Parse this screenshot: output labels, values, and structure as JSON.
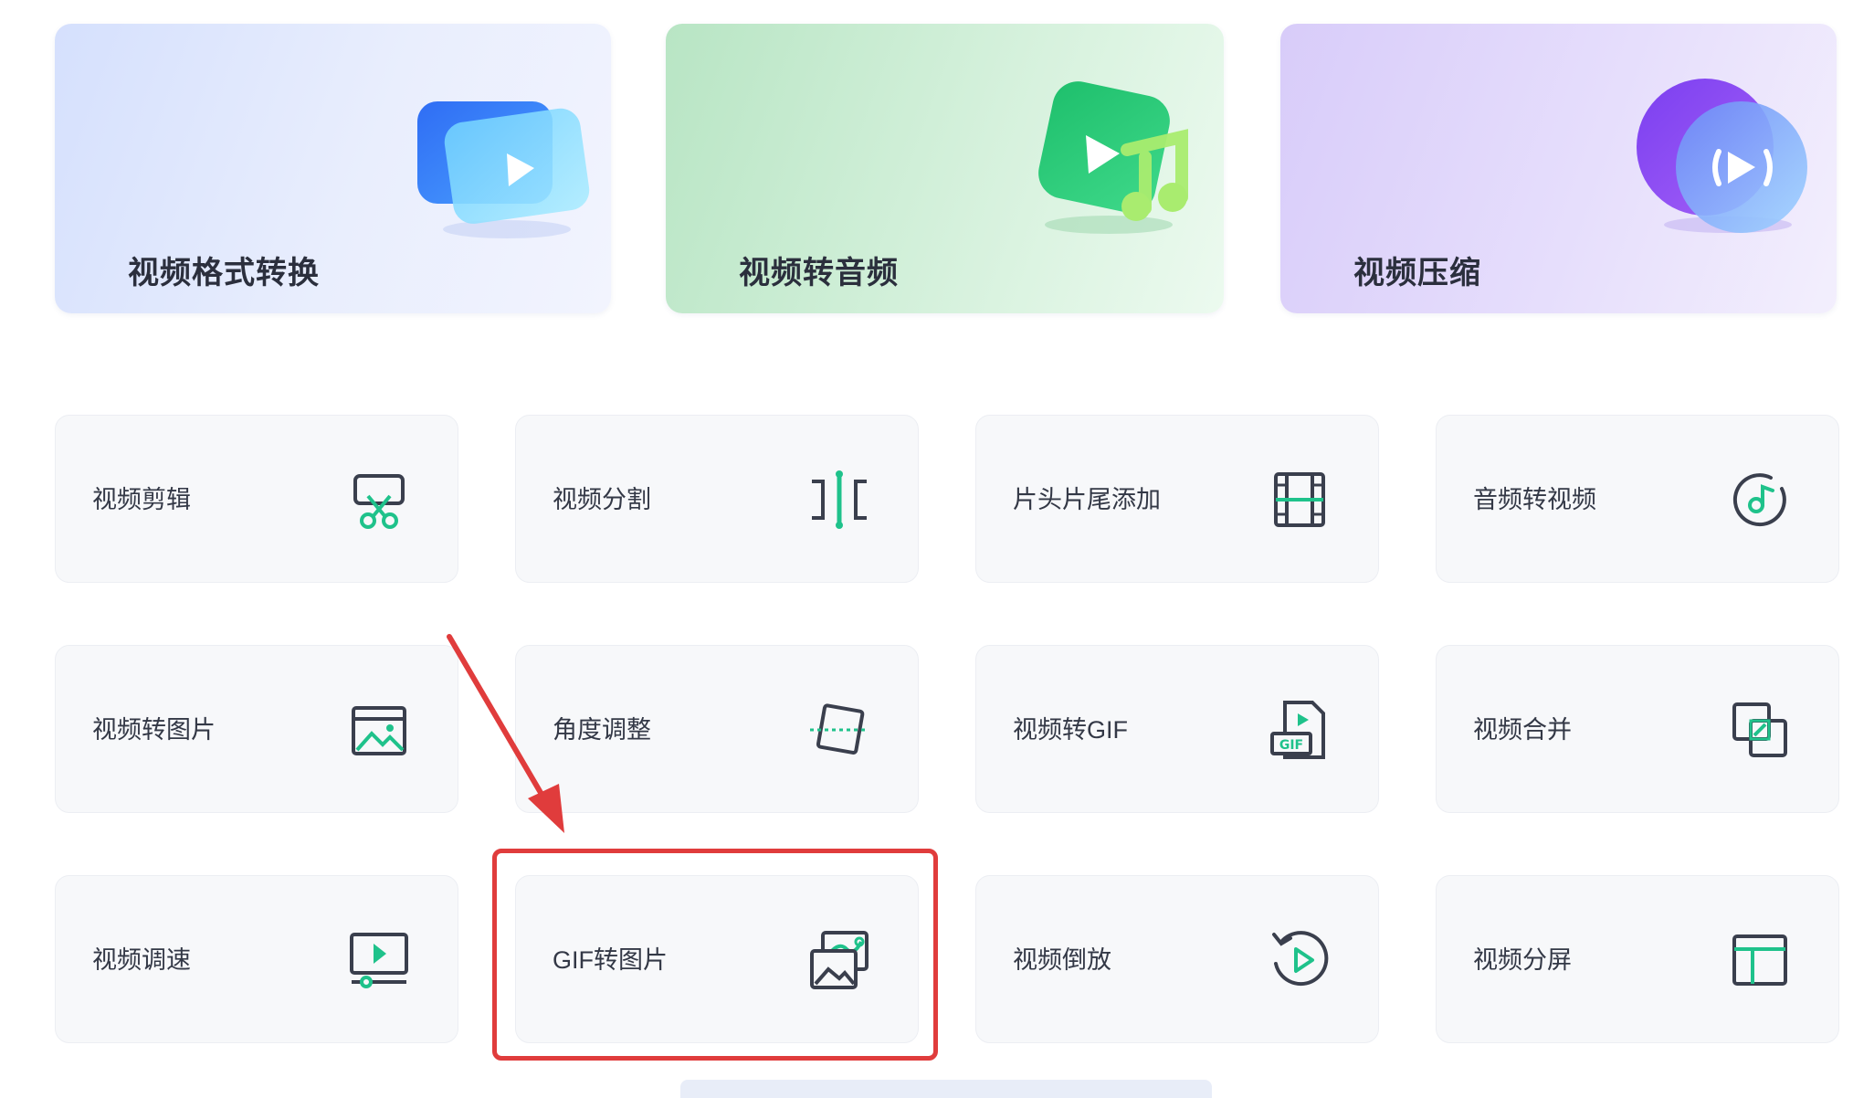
{
  "hero_cards": [
    {
      "title": "视频格式转换",
      "icon": "video-play-icon",
      "gradient": [
        "#d7e2fd",
        "#eef1fd"
      ]
    },
    {
      "title": "视频转音频",
      "icon": "music-note-icon",
      "gradient": [
        "#b9e6c6",
        "#e8f8ec"
      ]
    },
    {
      "title": "视频压缩",
      "icon": "compress-icon",
      "gradient": [
        "#d9cdf9",
        "#f1ecfd"
      ]
    }
  ],
  "tools": [
    {
      "label": "视频剪辑",
      "icon": "scissors-icon"
    },
    {
      "label": "视频分割",
      "icon": "split-icon"
    },
    {
      "label": "片头片尾添加",
      "icon": "film-strip-icon"
    },
    {
      "label": "音频转视频",
      "icon": "audio-disc-icon"
    },
    {
      "label": "视频转图片",
      "icon": "image-icon"
    },
    {
      "label": "角度调整",
      "icon": "rotate-frame-icon"
    },
    {
      "label": "视频转GIF",
      "icon": "gif-file-icon"
    },
    {
      "label": "视频合并",
      "icon": "merge-icon"
    },
    {
      "label": "视频调速",
      "icon": "speed-icon"
    },
    {
      "label": "GIF转图片",
      "icon": "gif-image-icon"
    },
    {
      "label": "视频倒放",
      "icon": "reverse-play-icon"
    },
    {
      "label": "视频分屏",
      "icon": "split-screen-icon"
    }
  ],
  "colors": {
    "accent": "#1fc28b",
    "icon_stroke": "#3a3f4d",
    "highlight": "#e03c3c"
  }
}
